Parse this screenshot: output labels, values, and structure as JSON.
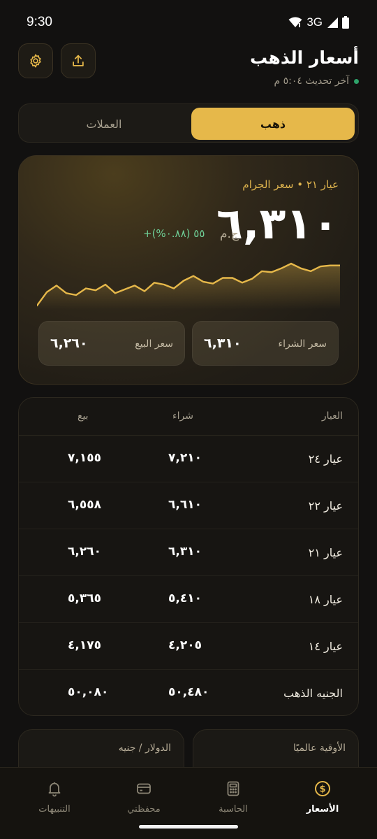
{
  "status_bar": {
    "time": "9:30",
    "network": "3G"
  },
  "header": {
    "title": "أسعار الذهب",
    "last_update": "آخر تحديث ٥:٠٤ م"
  },
  "segment": {
    "gold": "ذهب",
    "currencies": "العملات",
    "active": "gold"
  },
  "hero": {
    "subtitle": "عيار ٢١ • سعر الجرام",
    "price": "٦,٣١٠",
    "currency": "ج.م",
    "change": "+٥٥ (٠.٨٨%)",
    "trend_color": "#e6b84a",
    "buy_label": "سعر الشراء",
    "buy_value": "٦,٣١٠",
    "sell_label": "سعر البيع",
    "sell_value": "٦,٢٦٠",
    "sparkline": [
      20,
      34,
      41,
      33,
      31,
      38,
      36,
      42,
      33,
      37,
      41,
      35,
      44,
      42,
      38,
      46,
      51,
      45,
      43,
      49,
      49,
      44,
      48,
      56,
      55,
      59,
      64,
      59,
      56,
      61,
      62,
      62
    ]
  },
  "table": {
    "headers": {
      "name": "العيار",
      "buy": "شراء",
      "sell": "بيع"
    },
    "rows": [
      {
        "name": "عيار ٢٤",
        "buy": "٧,٢١٠",
        "sell": "٧,١٥٥"
      },
      {
        "name": "عيار ٢٢",
        "buy": "٦,٦١٠",
        "sell": "٦,٥٥٨"
      },
      {
        "name": "عيار ٢١",
        "buy": "٦,٣١٠",
        "sell": "٦,٢٦٠"
      },
      {
        "name": "عيار ١٨",
        "buy": "٥,٤١٠",
        "sell": "٥,٣٦٥"
      },
      {
        "name": "عيار ١٤",
        "buy": "٤,٢٠٥",
        "sell": "٤,١٧٥"
      },
      {
        "name": "الجنيه الذهب",
        "buy": "٥٠,٤٨٠",
        "sell": "٥٠,٠٨٠"
      }
    ]
  },
  "mini_cards": {
    "ounce_label": "الأوقية عالميًا",
    "usd_label": "الدولار / جنيه"
  },
  "nav": {
    "prices": "الأسعار",
    "calculator": "الحاسبة",
    "wallet": "محفظتي",
    "alerts": "التنبيهات",
    "active": "prices"
  },
  "colors": {
    "accent": "#e6b84a",
    "background": "#121110",
    "positive": "#6fcf97"
  }
}
